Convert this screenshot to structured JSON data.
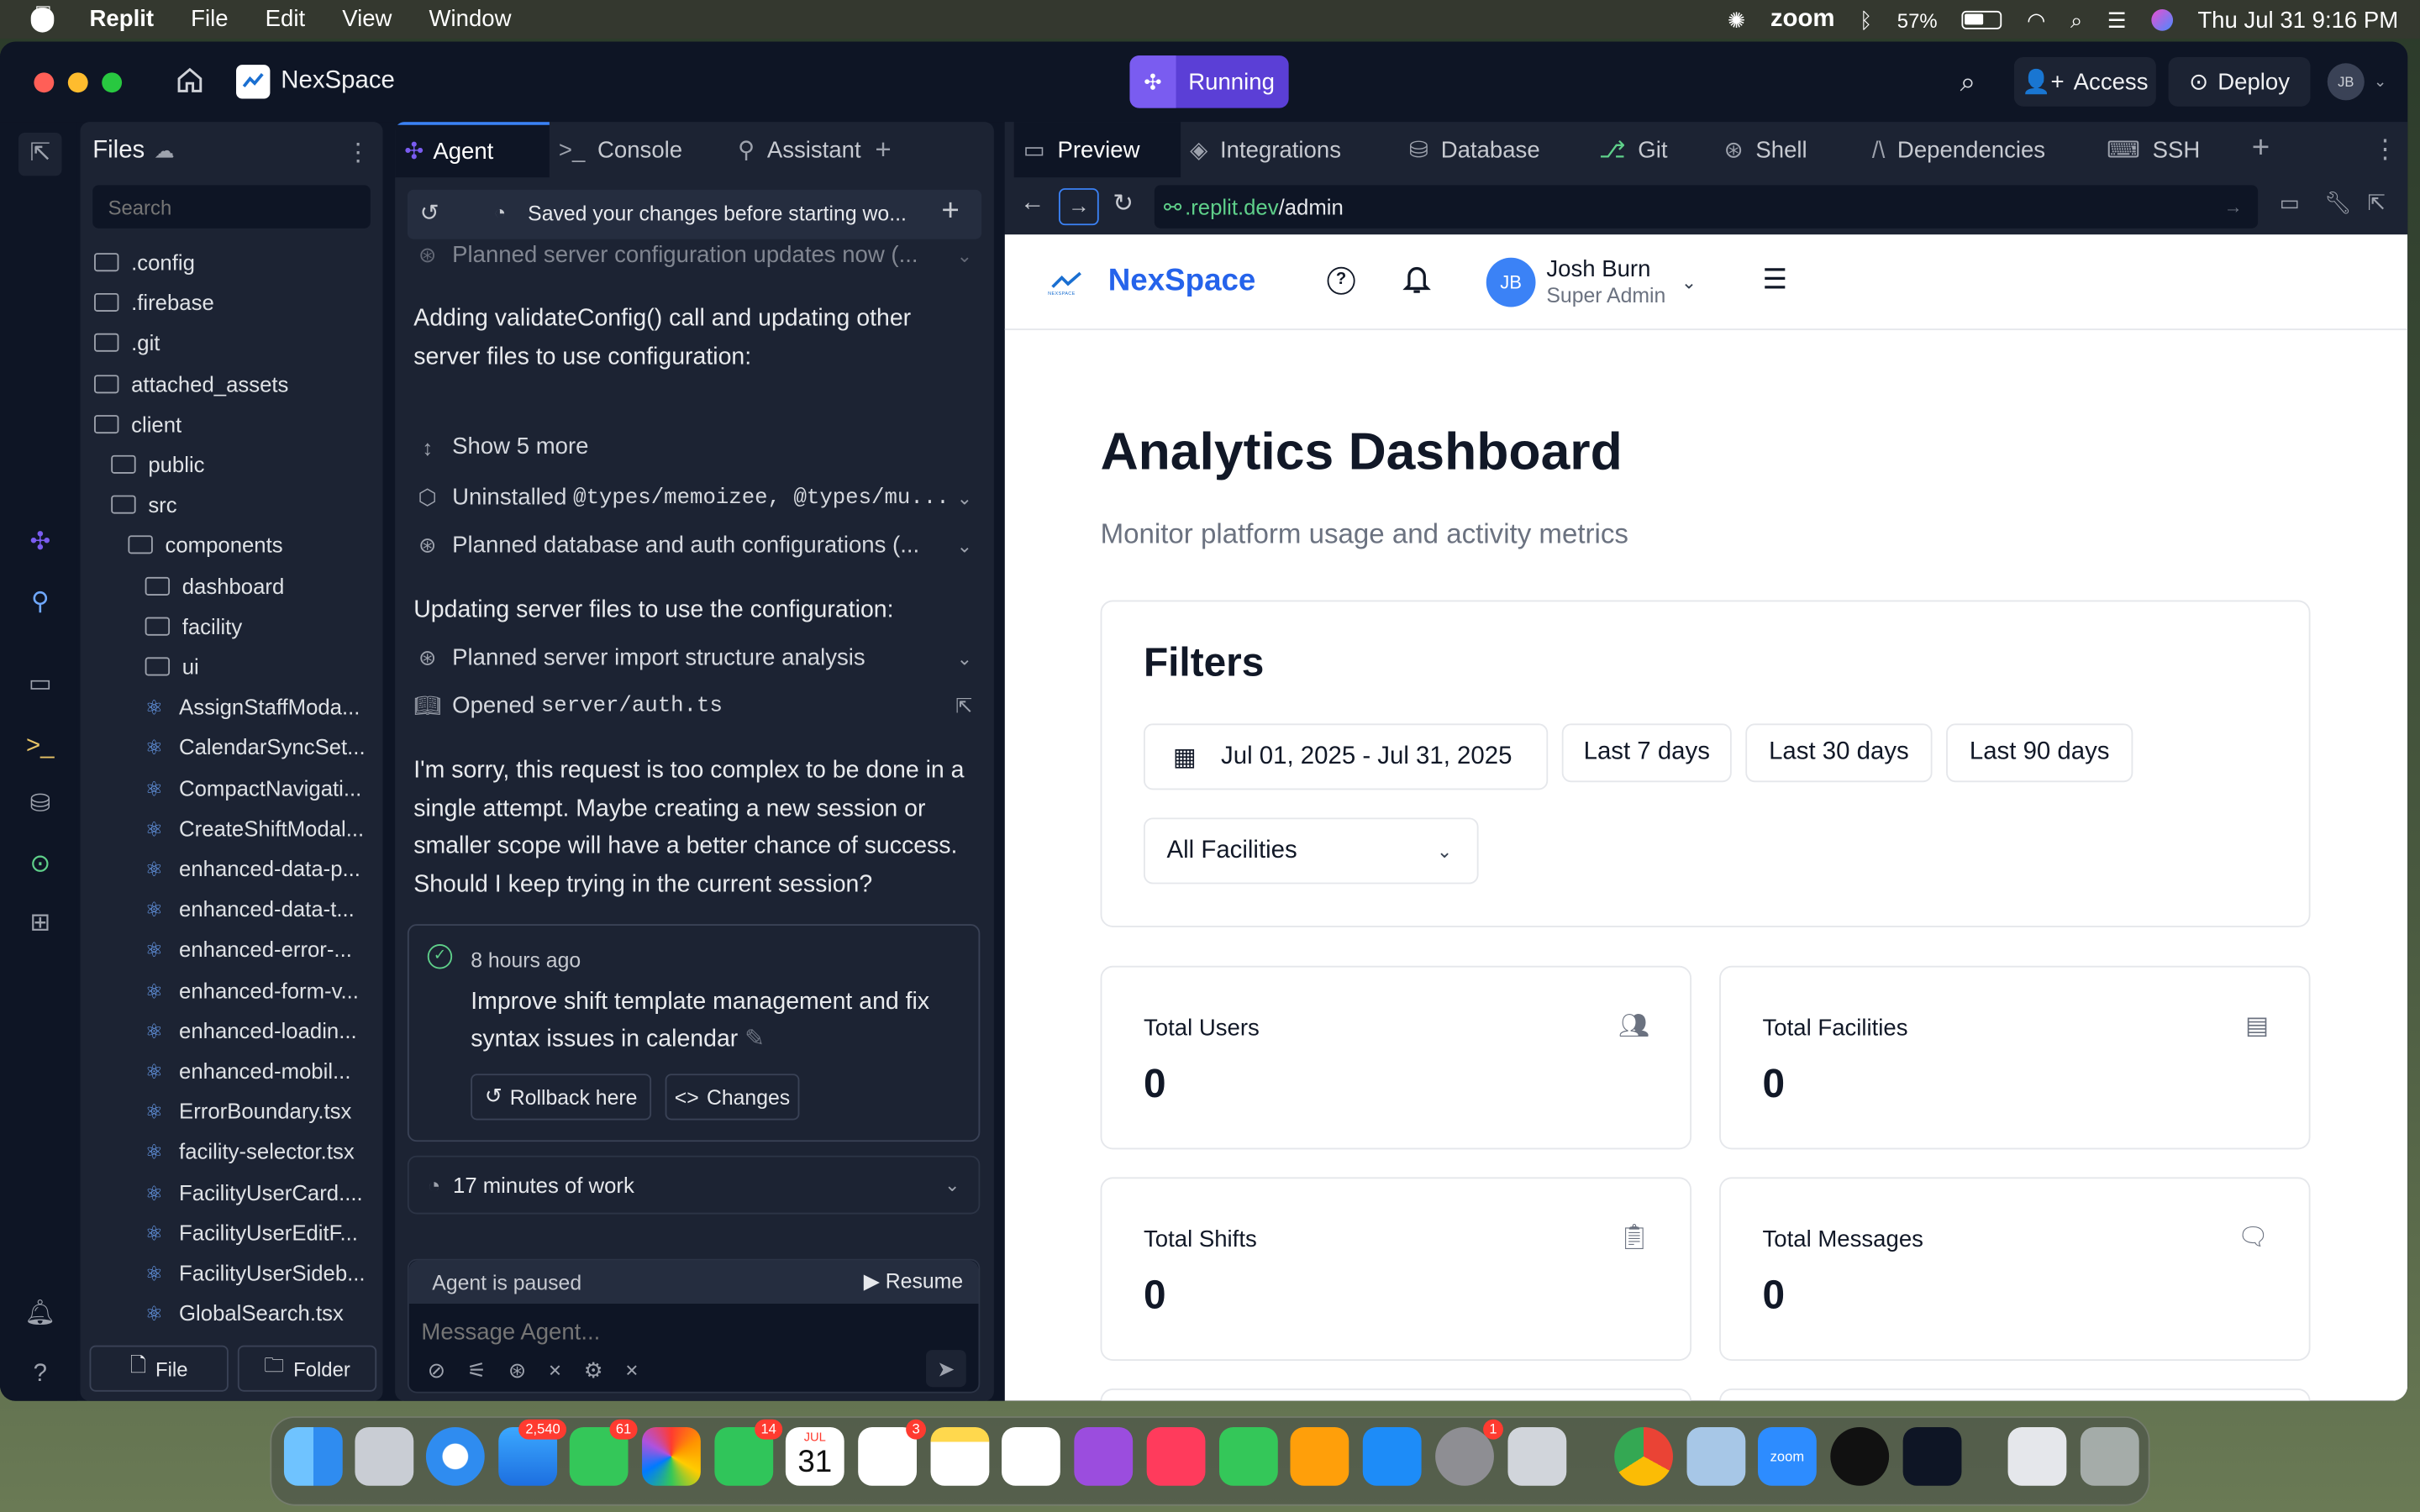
{
  "menubar": {
    "app": "Replit",
    "items": [
      "File",
      "Edit",
      "View",
      "Window"
    ],
    "zoom": "zoom",
    "battery": "57%",
    "datetime": "Thu Jul 31  9:16 PM"
  },
  "titlebar": {
    "project": "NexSpace",
    "status": "Running",
    "access": "Access",
    "deploy": "Deploy",
    "avatar": "JB"
  },
  "files": {
    "title": "Files",
    "search_placeholder": "Search",
    "tree": [
      {
        "name": ".config",
        "type": "folder",
        "depth": 0
      },
      {
        "name": ".firebase",
        "type": "folder",
        "depth": 0
      },
      {
        "name": ".git",
        "type": "folder",
        "depth": 0
      },
      {
        "name": "attached_assets",
        "type": "folder",
        "depth": 0
      },
      {
        "name": "client",
        "type": "folder-open",
        "depth": 0
      },
      {
        "name": "public",
        "type": "folder",
        "depth": 1
      },
      {
        "name": "src",
        "type": "folder-open",
        "depth": 1
      },
      {
        "name": "components",
        "type": "folder-open",
        "depth": 2
      },
      {
        "name": "dashboard",
        "type": "folder",
        "depth": 3
      },
      {
        "name": "facility",
        "type": "folder",
        "depth": 3
      },
      {
        "name": "ui",
        "type": "folder",
        "depth": 3
      },
      {
        "name": "AssignStaffModa...",
        "type": "react",
        "depth": 3
      },
      {
        "name": "CalendarSyncSet...",
        "type": "react",
        "depth": 3
      },
      {
        "name": "CompactNavigati...",
        "type": "react",
        "depth": 3
      },
      {
        "name": "CreateShiftModal...",
        "type": "react",
        "depth": 3
      },
      {
        "name": "enhanced-data-p...",
        "type": "react",
        "depth": 3
      },
      {
        "name": "enhanced-data-t...",
        "type": "react",
        "depth": 3
      },
      {
        "name": "enhanced-error-...",
        "type": "react",
        "depth": 3
      },
      {
        "name": "enhanced-form-v...",
        "type": "react",
        "depth": 3
      },
      {
        "name": "enhanced-loadin...",
        "type": "react",
        "depth": 3
      },
      {
        "name": "enhanced-mobil...",
        "type": "react",
        "depth": 3
      },
      {
        "name": "ErrorBoundary.tsx",
        "type": "react",
        "depth": 3
      },
      {
        "name": "facility-selector.tsx",
        "type": "react",
        "depth": 3
      },
      {
        "name": "FacilityUserCard....",
        "type": "react",
        "depth": 3
      },
      {
        "name": "FacilityUserEditF...",
        "type": "react",
        "depth": 3
      },
      {
        "name": "FacilityUserSideb...",
        "type": "react",
        "depth": 3
      },
      {
        "name": "GlobalSearch.tsx",
        "type": "react",
        "depth": 3
      }
    ],
    "new_file": "File",
    "new_folder": "Folder"
  },
  "agent": {
    "tabs": [
      "Agent",
      "Console",
      "Assistant"
    ],
    "saved_banner": "Saved your changes before starting wo...",
    "faded_row": "Planned server configuration updates now (...",
    "text1": "Adding validateConfig() call and updating other server files to use configuration:",
    "show_more": "Show 5 more",
    "uninstalled_prefix": "Uninstalled ",
    "uninstalled_mono": "@types/memoizee, @types/mu...",
    "planned_db": "Planned database and auth configurations (...",
    "text2": "Updating server files to use the configuration:",
    "planned_import": "Planned server import structure analysis",
    "opened_prefix": "Opened ",
    "opened_file": "server/auth.ts",
    "text3": "I'm sorry, this request is too complex to be done in a single attempt. Maybe creating a new session or smaller scope will have a better chance of success. Should I keep trying in the current session?",
    "checkpoint_time": "8 hours ago",
    "checkpoint_msg": "Improve shift template management and fix syntax issues in calendar",
    "rollback": "Rollback here",
    "changes": "Changes",
    "work_time": "17 minutes of work",
    "paused": "Agent is paused",
    "resume": "Resume",
    "input_placeholder": "Message Agent..."
  },
  "preview": {
    "tabs": [
      "Preview",
      "Integrations",
      "Database",
      "Git",
      "Shell",
      "Dependencies",
      "SSH"
    ],
    "url_prefix": ".replit.dev",
    "url_path": "/admin"
  },
  "site": {
    "logo_small": "NEXSPACE",
    "brand": "NexSpace",
    "user_initials": "JB",
    "user_name": "Josh Burn",
    "user_role": "Super Admin",
    "page_title": "Analytics Dashboard",
    "page_subtitle": "Monitor platform usage and activity metrics",
    "filters_title": "Filters",
    "date_range": "Jul 01, 2025 - Jul 31, 2025",
    "presets": [
      "Last 7 days",
      "Last 30 days",
      "Last 90 days"
    ],
    "facility_select": "All Facilities",
    "stats": [
      {
        "label": "Total Users",
        "value": "0",
        "icon": "users-icon"
      },
      {
        "label": "Total Facilities",
        "value": "0",
        "icon": "building-icon"
      },
      {
        "label": "Total Shifts",
        "value": "0",
        "icon": "clipboard-icon"
      },
      {
        "label": "Total Messages",
        "value": "0",
        "icon": "message-icon"
      }
    ]
  },
  "dock": {
    "mail_badge": "2,540",
    "messages_badge": "61",
    "facetime_badge": "14",
    "calendar_month": "JUL",
    "calendar_day": "31",
    "reminders_badge": "3",
    "settings_badge": "1",
    "zoom_label": "zoom"
  }
}
